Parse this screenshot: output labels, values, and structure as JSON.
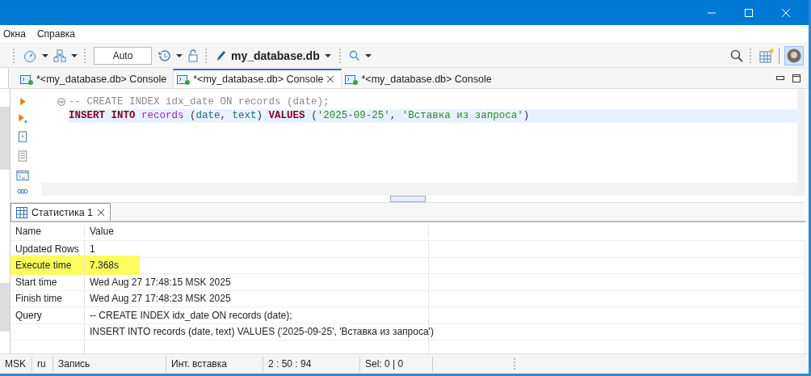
{
  "menu": [
    {
      "label": "Окна"
    },
    {
      "label": "Справка"
    }
  ],
  "toolbar": {
    "commit_mode": "Auto",
    "database": "my_database.db"
  },
  "editor_tabs": [
    {
      "label": "*<my_database.db> Console",
      "selected": false
    },
    {
      "label": "*<my_database.db> Console",
      "selected": true
    },
    {
      "label": "*<my_database.db> Console",
      "selected": false
    }
  ],
  "code": [
    {
      "current": false,
      "tokens": [
        {
          "kind": "comment",
          "text": "-- CREATE INDEX idx_date ON records (date);"
        }
      ]
    },
    {
      "current": true,
      "tokens": [
        {
          "kind": "keyword",
          "text": "INSERT INTO"
        },
        {
          "kind": "table",
          "text": " records"
        },
        {
          "kind": "plain",
          "text": " ("
        },
        {
          "kind": "column",
          "text": "date"
        },
        {
          "kind": "plain",
          "text": ", "
        },
        {
          "kind": "column",
          "text": "text"
        },
        {
          "kind": "plain",
          "text": ") "
        },
        {
          "kind": "keyword",
          "text": "VALUES"
        },
        {
          "kind": "plain",
          "text": " ("
        },
        {
          "kind": "string",
          "text": "'2025-09-25'"
        },
        {
          "kind": "plain",
          "text": ", "
        },
        {
          "kind": "string",
          "text": "'Вставка из запроса'"
        },
        {
          "kind": "plain",
          "text": ")"
        }
      ]
    }
  ],
  "results": {
    "tab": {
      "label": "Статистика 1",
      "selected": true
    },
    "columns": [
      "Name",
      "Value"
    ],
    "rows": [
      {
        "name": "Updated Rows",
        "value": "1",
        "highlighted": false
      },
      {
        "name": "Execute time",
        "value": "7.368s",
        "highlighted": true
      },
      {
        "name": "Start time",
        "value": "Wed Aug 27 17:48:15 MSK 2025",
        "highlighted": false
      },
      {
        "name": "Finish time",
        "value": "Wed Aug 27 17:48:23 MSK 2025",
        "highlighted": false
      },
      {
        "name": "Query",
        "value": "-- CREATE INDEX idx_date ON records (date);",
        "highlighted": false
      },
      {
        "value": "INSERT INTO records (date, text) VALUES ('2025-09-25', 'Вставка из запроса')",
        "highlighted": false
      }
    ]
  },
  "status_bar": [
    "MSK",
    "ru",
    "Запись",
    "Инт. вставка",
    "2 : 50 : 94",
    "Sel: 0 | 0"
  ]
}
